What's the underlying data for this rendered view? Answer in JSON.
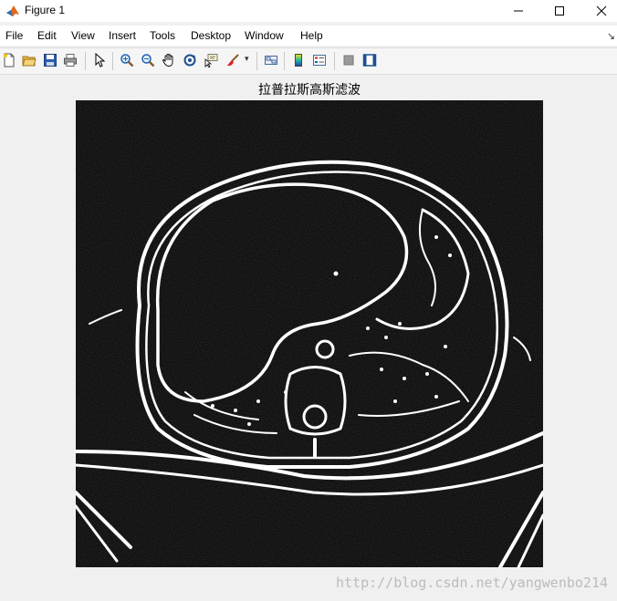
{
  "window": {
    "title": "Figure 1",
    "minimize_glyph": "—",
    "maximize_glyph": "☐",
    "close_glyph": "✕"
  },
  "menu": {
    "items": [
      "File",
      "Edit",
      "View",
      "Insert",
      "Tools",
      "Desktop",
      "Window",
      "Help"
    ],
    "dock_glyph": "↘"
  },
  "toolbar": {
    "buttons": [
      {
        "icon": "new-figure-icon"
      },
      {
        "icon": "open-file-icon"
      },
      {
        "icon": "save-icon"
      },
      {
        "icon": "print-icon"
      },
      {
        "icon": "edit-plot-icon"
      },
      {
        "icon": "zoom-in-icon"
      },
      {
        "icon": "zoom-out-icon"
      },
      {
        "icon": "pan-icon"
      },
      {
        "icon": "rotate-3d-icon"
      },
      {
        "icon": "data-cursor-icon"
      },
      {
        "icon": "brush-icon"
      },
      {
        "icon": "link-plot-icon"
      },
      {
        "icon": "colorbar-icon"
      },
      {
        "icon": "legend-icon"
      },
      {
        "icon": "hide-plot-tools-icon"
      },
      {
        "icon": "show-plot-tools-icon"
      }
    ],
    "brush_dropdown_glyph": "▾"
  },
  "axes": {
    "title": "拉普拉斯高斯滤波"
  },
  "image": {
    "description_colors": {
      "background": "#000000",
      "edges": "#ffffff"
    }
  },
  "watermark": {
    "text": "http://blog.csdn.net/yangwenbo214"
  },
  "colors": {
    "titlebar": "#ffffff",
    "figure_bg": "#f0f0f0",
    "matlab_orange": "#e06a1b"
  }
}
